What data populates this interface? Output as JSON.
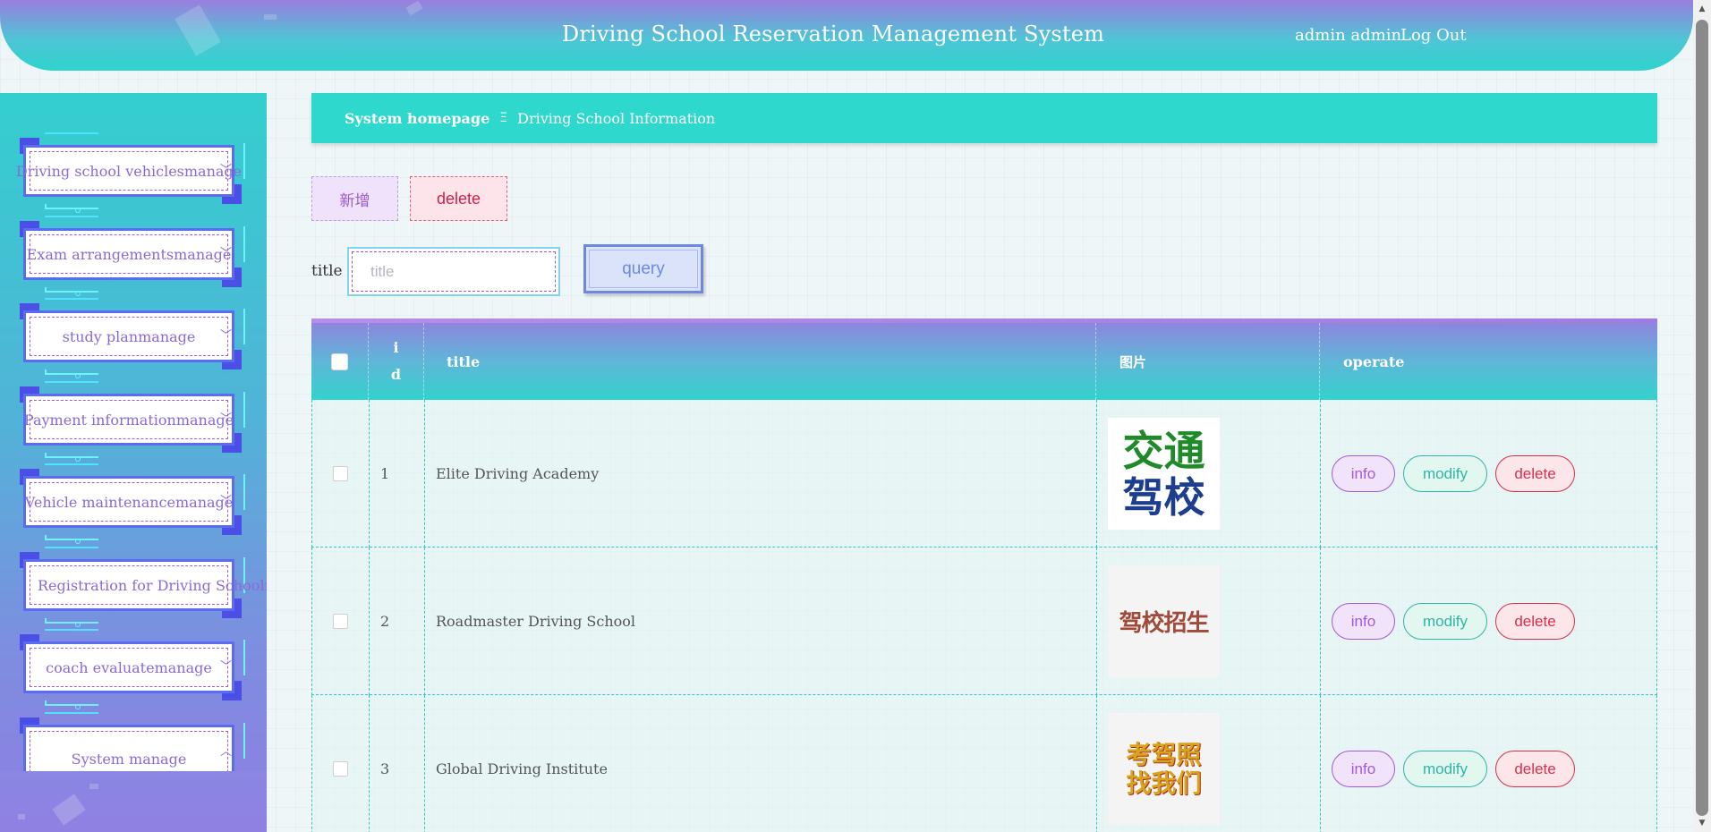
{
  "header": {
    "title": "Driving School Reservation Management System",
    "user": "admin admin",
    "logout_label": "Log Out"
  },
  "sidebar": {
    "items": [
      {
        "label": "Driving school vehiclesmanage",
        "expanded": false
      },
      {
        "label": "Exam arrangementsmanage",
        "expanded": false
      },
      {
        "label": "study planmanage",
        "expanded": false
      },
      {
        "label": "Payment informationmanage",
        "expanded": false
      },
      {
        "label": "Vehicle maintenancemanage",
        "expanded": false
      },
      {
        "label": "Registration for Driving Schoolmanage",
        "expanded": false
      },
      {
        "label": "coach evaluatemanage",
        "expanded": false
      },
      {
        "label": "System manage",
        "expanded": true
      }
    ]
  },
  "breadcrumb": {
    "home": "System homepage",
    "separator": "Ξ",
    "current": "Driving School Information"
  },
  "toolbar": {
    "add_label": "新增",
    "delete_label": "delete"
  },
  "search": {
    "label": "title",
    "placeholder": "title",
    "value": "",
    "query_label": "query"
  },
  "table": {
    "columns": {
      "id": [
        "i",
        "d"
      ],
      "title": "title",
      "image": "图片",
      "operate": "operate"
    },
    "rows": [
      {
        "id": "1",
        "title": "Elite Driving Academy",
        "image": {
          "line1": "交通",
          "line2": "驾校"
        }
      },
      {
        "id": "2",
        "title": "Roadmaster Driving School",
        "image": {
          "line1": "驾校招生",
          "line2": ""
        }
      },
      {
        "id": "3",
        "title": "Global Driving Institute",
        "image": {
          "line1": "考驾照",
          "line2": "找我们"
        }
      }
    ],
    "actions": {
      "info": "info",
      "modify": "modify",
      "delete": "delete"
    }
  },
  "colors": {
    "accent_teal": "#2ed8cd",
    "accent_purple": "#9a7ede",
    "danger": "#d5304e"
  }
}
